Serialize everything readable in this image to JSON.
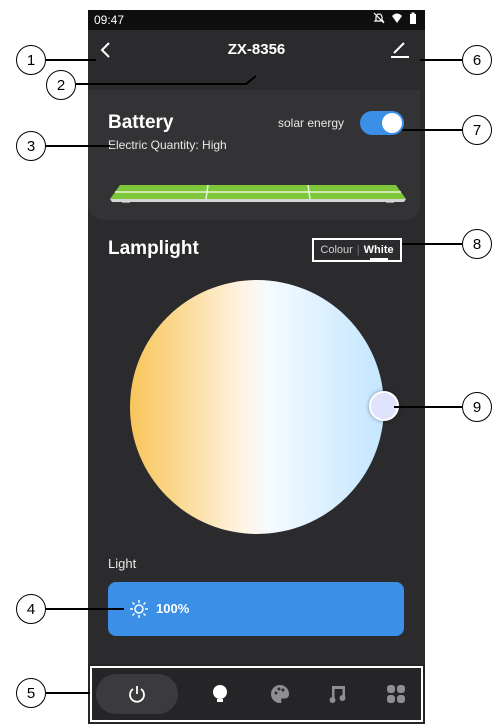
{
  "status_bar": {
    "time": "09:47"
  },
  "header": {
    "device_name": "ZX-8356"
  },
  "battery": {
    "title": "Battery",
    "subtitle": "Electric Quantity: High",
    "solar_label": "solar energy",
    "solar_enabled": true
  },
  "lamplight": {
    "title": "Lamplight",
    "mode_colour": "Colour",
    "mode_white": "White",
    "selected_mode": "White"
  },
  "light": {
    "label": "Light",
    "brightness_text": "100%",
    "brightness": 1.0
  },
  "bottom_nav": {
    "items": [
      {
        "icon": "power-icon",
        "active": true
      },
      {
        "icon": "bulb-icon",
        "active": false
      },
      {
        "icon": "palette-icon",
        "active": false
      },
      {
        "icon": "music-icon",
        "active": false
      },
      {
        "icon": "scenes-grid-icon",
        "active": false
      }
    ]
  },
  "annotations": [
    "1",
    "2",
    "3",
    "4",
    "5",
    "6",
    "7",
    "8",
    "9"
  ],
  "colors": {
    "accent": "#3b8fe6",
    "background": "#2b2b2d",
    "battery_green": "#7ec63a"
  }
}
